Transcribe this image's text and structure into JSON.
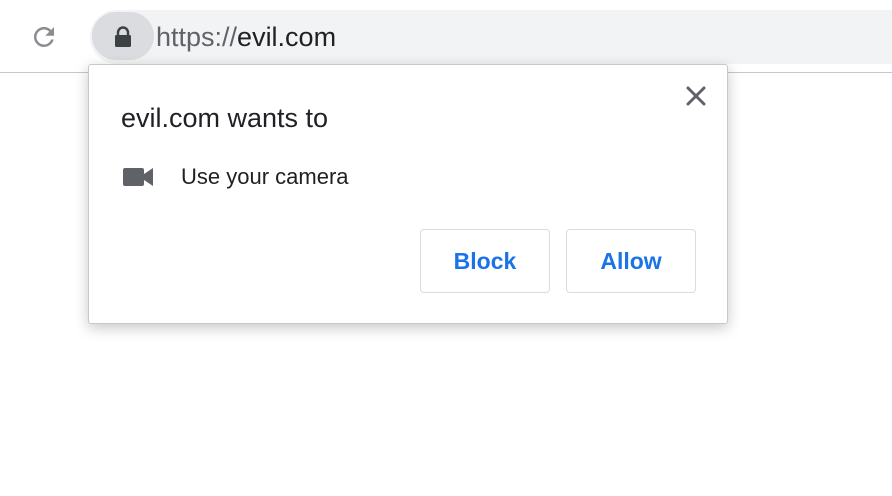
{
  "browser": {
    "reload_icon": "reload-icon",
    "lock_icon": "lock-icon",
    "url_scheme": "https://",
    "url_host": "evil.com"
  },
  "permission_prompt": {
    "title": "evil.com wants to",
    "permission_icon": "camera-icon",
    "permission_label": "Use your camera",
    "close_icon": "close-icon",
    "block_label": "Block",
    "allow_label": "Allow"
  },
  "colors": {
    "accent": "#1a73e8",
    "omnibox_bg": "#f1f3f4",
    "icon_gray": "#5f6368",
    "text": "#202124"
  }
}
